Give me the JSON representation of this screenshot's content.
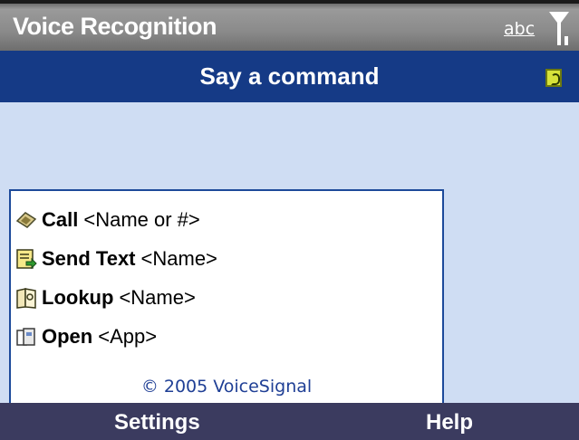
{
  "titlebar": {
    "title": "Voice Recognition",
    "input_mode": "abc",
    "icons": [
      "signal-antenna-icon"
    ]
  },
  "prompt": {
    "text": "Say a command",
    "icon": "listening-ear-icon"
  },
  "commands": [
    {
      "verb": "Call",
      "arg": "<Name or #>",
      "icon": "phone-icon"
    },
    {
      "verb": "Send Text",
      "arg": "<Name>",
      "icon": "message-icon"
    },
    {
      "verb": "Lookup",
      "arg": "<Name>",
      "icon": "contacts-book-icon"
    },
    {
      "verb": "Open",
      "arg": "<App>",
      "icon": "folder-open-icon"
    }
  ],
  "copyright": "© 2005 VoiceSignal",
  "softkeys": {
    "left": "Settings",
    "right": "Help"
  },
  "colors": {
    "prompt_bar": "#153a86",
    "background": "#cfddf3",
    "softkey_bar": "#3b3b5f",
    "copyright_text": "#1f3f95"
  }
}
